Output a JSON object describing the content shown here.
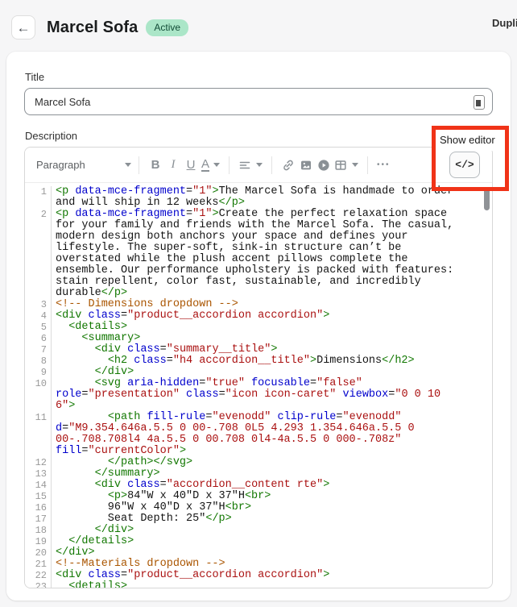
{
  "header": {
    "title": "Marcel Sofa",
    "status": "Active",
    "status_bg": "#abe6c8",
    "status_text": "#114b36",
    "action": "Duplicate"
  },
  "card": {
    "title_label": "Title",
    "title_value": "Marcel Sofa",
    "description_label": "Description"
  },
  "toolbar": {
    "paragraph": "Paragraph",
    "bold": "B",
    "italic": "I",
    "underline": "U",
    "text_color": "A",
    "more": "•••",
    "code_view": "</>",
    "icons": [
      "align-left-icon",
      "link-icon",
      "image-icon",
      "video-icon",
      "table-icon"
    ],
    "icon_color": "#8a9095"
  },
  "annotation": {
    "label": "Show editor",
    "color": "#f03318"
  },
  "editor": {
    "colors": {
      "tag": "#117700",
      "attribute": "#0000cc",
      "string": "#aa1111",
      "comment": "#aa5500",
      "plain": "#141414",
      "line_number": "#999999"
    },
    "lines": [
      {
        "n": 1,
        "text": "<p data-mce-fragment=\"1\">The Marcel Sofa is handmade to order\nand will ship in 12 weeks</p>"
      },
      {
        "n": 2,
        "text": "<p data-mce-fragment=\"1\">Create the perfect relaxation space\nfor your family and friends with the Marcel Sofa. The casual,\nmodern design both anchors your space and defines your\nlifestyle. The super-soft, sink-in structure can’t be\noverstated while the plush accent pillows complete the\nensemble. Our performance upholstery is packed with features:\nstain repellent, color fast, sustainable, and incredibly\ndurable</p>"
      },
      {
        "n": 3,
        "text": "<!-- Dimensions dropdown -->"
      },
      {
        "n": 4,
        "text": "<div class=\"product__accordion accordion\">"
      },
      {
        "n": 5,
        "text": "  <details>"
      },
      {
        "n": 6,
        "text": "    <summary>"
      },
      {
        "n": 7,
        "text": "      <div class=\"summary__title\">"
      },
      {
        "n": 8,
        "text": "        <h2 class=\"h4 accordion__title\">Dimensions</h2>"
      },
      {
        "n": 9,
        "text": "      </div>"
      },
      {
        "n": 10,
        "text": "      <svg aria-hidden=\"true\" focusable=\"false\"\nrole=\"presentation\" class=\"icon icon-caret\" viewbox=\"0 0 10\n6\">"
      },
      {
        "n": 11,
        "text": "        <path fill-rule=\"evenodd\" clip-rule=\"evenodd\"\nd=\"M9.354.646a.5.5 0 00-.708 0L5 4.293 1.354.646a.5.5 0\n00-.708.708l4 4a.5.5 0 00.708 0l4-4a.5.5 0 000-.708z\"\nfill=\"currentColor\">"
      },
      {
        "n": 12,
        "text": "        </path></svg>"
      },
      {
        "n": 13,
        "text": "      </summary>"
      },
      {
        "n": 14,
        "text": "      <div class=\"accordion__content rte\">"
      },
      {
        "n": 15,
        "text": "        <p>84\"W x 40\"D x 37\"H<br>"
      },
      {
        "n": 16,
        "text": "        96\"W x 40\"D x 37\"H<br>"
      },
      {
        "n": 17,
        "text": "        Seat Depth: 25\"</p>"
      },
      {
        "n": 18,
        "text": "      </div>"
      },
      {
        "n": 19,
        "text": "  </details>"
      },
      {
        "n": 20,
        "text": "</div>"
      },
      {
        "n": 21,
        "text": "<!--Materials dropdown -->"
      },
      {
        "n": 22,
        "text": "<div class=\"product__accordion accordion\">"
      },
      {
        "n": 23,
        "text": "  <details>"
      }
    ]
  }
}
